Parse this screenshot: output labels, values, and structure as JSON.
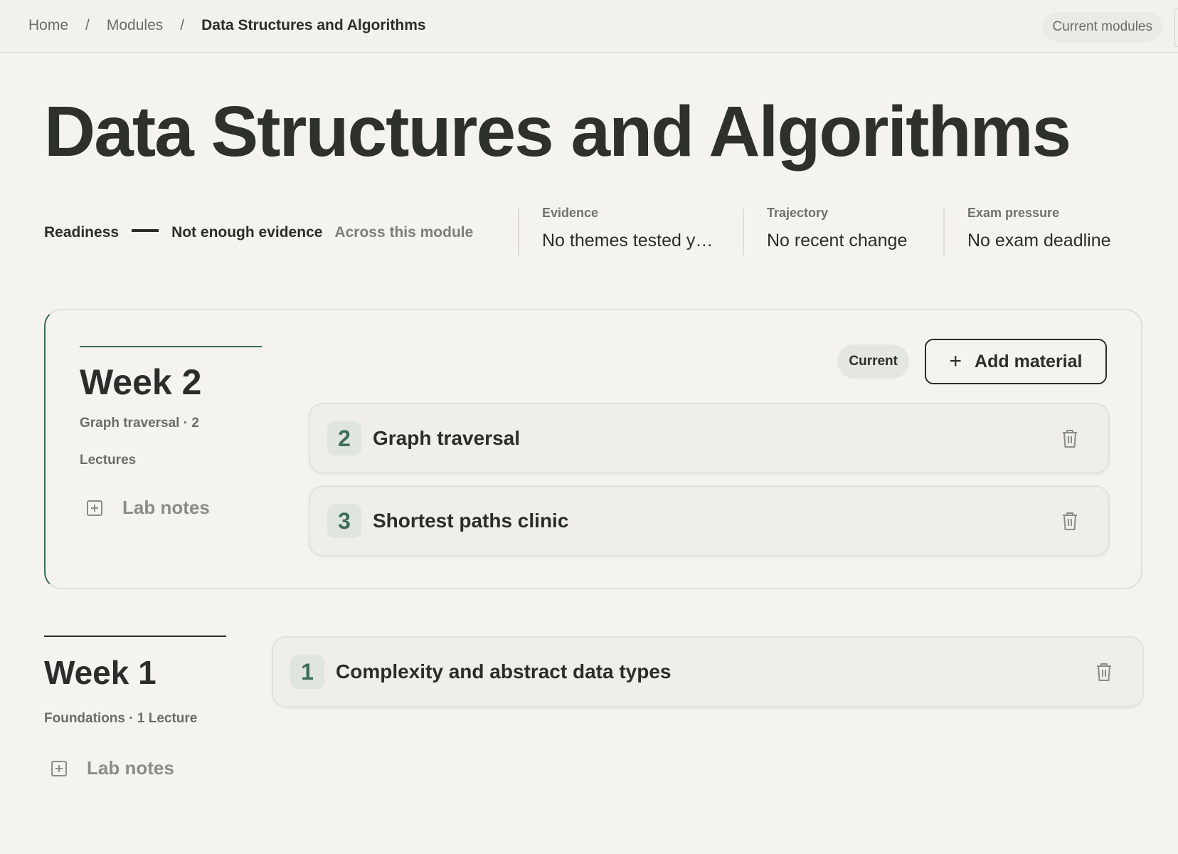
{
  "breadcrumb": {
    "items": [
      "Home",
      "Modules",
      "Data Structures and Algorithms"
    ],
    "separator": "/"
  },
  "header": {
    "current_modules_label": "Current modules"
  },
  "page_title": "Data Structures and Algorithms",
  "stats": {
    "readiness_label": "Readiness",
    "readiness_value": "Not enough evidence",
    "readiness_scope": "Across this module",
    "evidence": {
      "label": "Evidence",
      "value": "No themes tested y…"
    },
    "trajectory": {
      "label": "Trajectory",
      "value": "No recent change"
    },
    "exam_pressure": {
      "label": "Exam pressure",
      "value": "No exam deadline"
    }
  },
  "weeks": [
    {
      "title": "Week 2",
      "meta": "Graph traversal · 2",
      "meta2": "Lectures",
      "lab_notes_label": "Lab notes",
      "badge": "Current",
      "add_material_label": "Add material",
      "items": [
        {
          "number": "2",
          "name": "Graph traversal"
        },
        {
          "number": "3",
          "name": "Shortest paths clinic"
        }
      ]
    },
    {
      "title": "Week 1",
      "meta": "Foundations · 1 Lecture",
      "lab_notes_label": "Lab notes",
      "items": [
        {
          "number": "1",
          "name": "Complexity and abstract data types"
        }
      ]
    }
  ],
  "colors": {
    "background": "#f4f3ee",
    "accent": "#3e6d58",
    "text": "#2b2d2a",
    "muted": "#6a6d68"
  }
}
